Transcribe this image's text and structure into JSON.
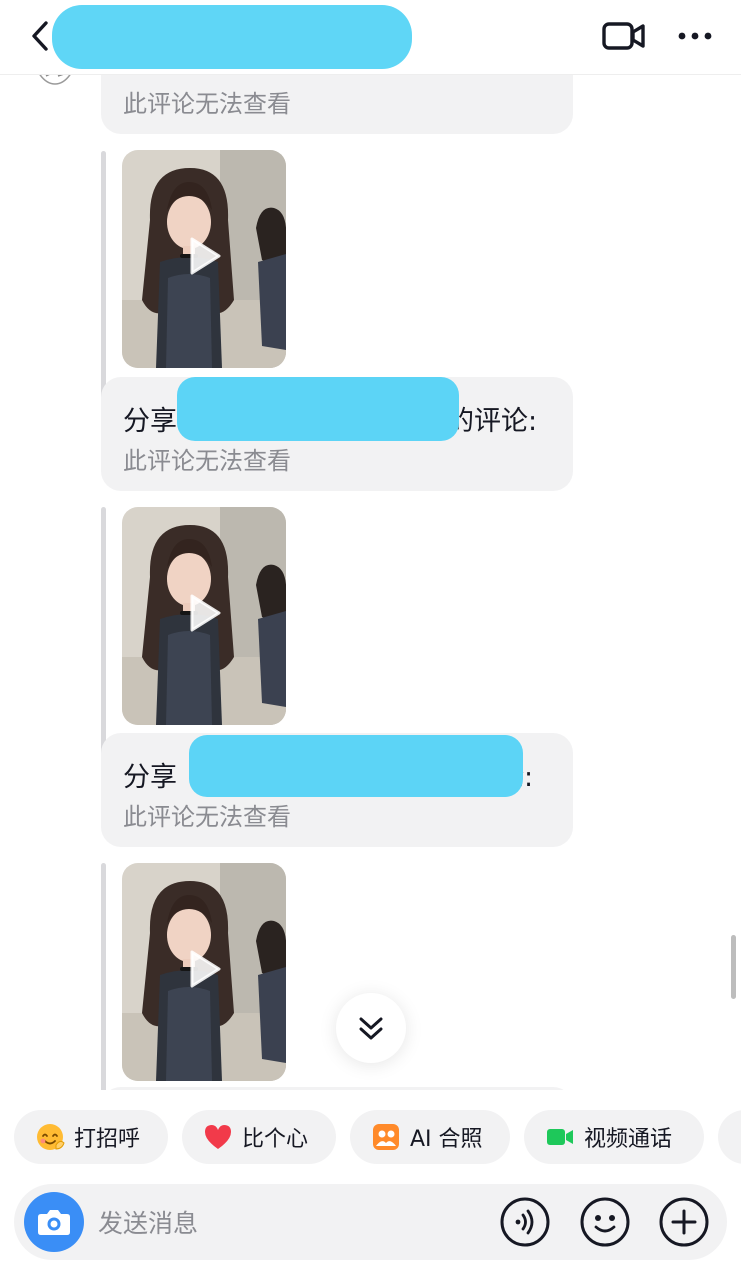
{
  "header": {
    "back_icon": "chevron-left-icon",
    "video_call_icon": "video-camera-icon",
    "more_icon": "more-dots-icon"
  },
  "messages": [
    {
      "type": "comment",
      "line2": "此评论无法查看"
    },
    {
      "type": "video"
    },
    {
      "type": "comment",
      "prefix": "分享",
      "suffix": "的评论:",
      "line2": "此评论无法查看"
    },
    {
      "type": "video"
    },
    {
      "type": "comment",
      "prefix": "分享",
      "suffix": "论:",
      "line2": "此评论无法查看"
    },
    {
      "type": "video"
    }
  ],
  "quick_actions": [
    {
      "label": "打招呼",
      "icon": "wave-emoji-icon"
    },
    {
      "label": "比个心",
      "icon": "heart-icon"
    },
    {
      "label": "AI 合照",
      "icon": "ai-photo-icon"
    },
    {
      "label": "视频通话",
      "icon": "video-call-icon"
    }
  ],
  "composer": {
    "placeholder": "发送消息",
    "camera_icon": "camera-icon",
    "voice_icon": "voice-icon",
    "emoji_icon": "emoji-icon",
    "plus_icon": "plus-icon"
  },
  "colors": {
    "bubble": "#f2f2f3",
    "redaction": "#5cd4f6",
    "camera_button": "#3a8ef6",
    "secondary_text": "#8a8b91"
  }
}
